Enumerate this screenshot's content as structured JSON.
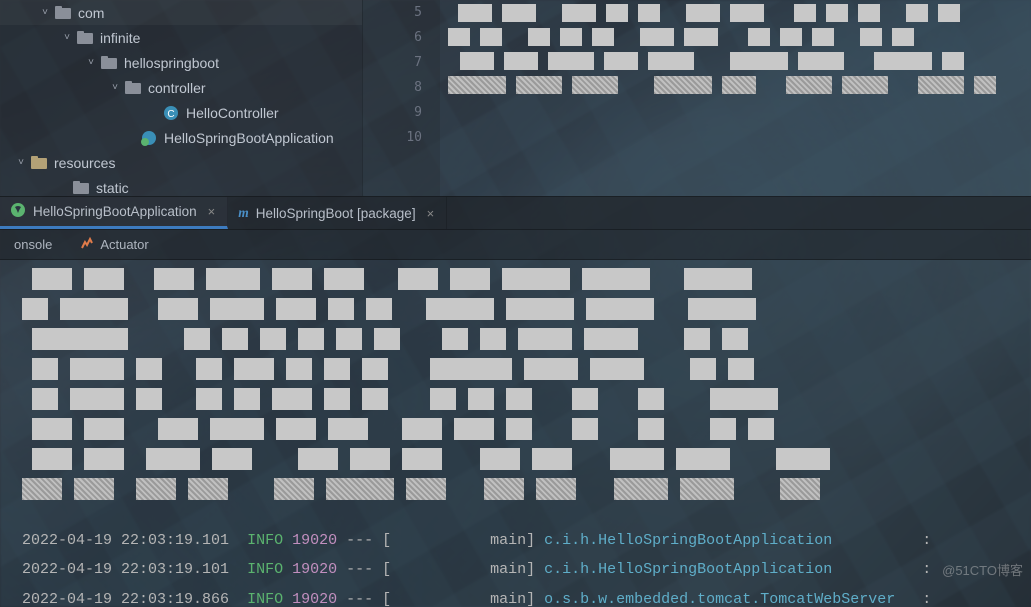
{
  "tree": {
    "items": [
      {
        "indent": 36,
        "arrow": "˅",
        "icon": "folder",
        "label": "com"
      },
      {
        "indent": 58,
        "arrow": "˅",
        "icon": "folder",
        "label": "infinite"
      },
      {
        "indent": 82,
        "arrow": "˅",
        "icon": "folder",
        "label": "hellospringboot"
      },
      {
        "indent": 106,
        "arrow": "˅",
        "icon": "folder",
        "label": "controller"
      },
      {
        "indent": 140,
        "arrow": "",
        "icon": "class",
        "label": "HelloController"
      },
      {
        "indent": 120,
        "arrow": "",
        "icon": "sbapp",
        "label": "HelloSpringBootApplication"
      },
      {
        "indent": 12,
        "arrow": "˅",
        "icon": "resfolder",
        "label": "resources"
      },
      {
        "indent": 52,
        "arrow": "",
        "icon": "folder",
        "label": "static"
      }
    ]
  },
  "gutter": {
    "start": 5,
    "count": 6
  },
  "run_tabs": [
    {
      "icon": "spring",
      "label": "HelloSpringBootApplication",
      "closeable": true,
      "active": true
    },
    {
      "icon": "maven",
      "label": "HelloSpringBoot [package]",
      "closeable": true,
      "active": false
    }
  ],
  "sub_tabs": [
    {
      "label": "onsole"
    },
    {
      "icon": "actuator",
      "label": "Actuator"
    }
  ],
  "logs": [
    {
      "date": "2022-04-19 22:03:19.101",
      "level": "INFO",
      "pid": "19020",
      "sep": " --- [",
      "thread": "           main] ",
      "cls": "c.i.h.HelloSpringBootApplication",
      "tail": "          :"
    },
    {
      "date": "2022-04-19 22:03:19.101",
      "level": "INFO",
      "pid": "19020",
      "sep": " --- [",
      "thread": "           main] ",
      "cls": "c.i.h.HelloSpringBootApplication",
      "tail": "          :"
    },
    {
      "date": "2022-04-19 22:03:19.866",
      "level": "INFO",
      "pid": "19020",
      "sep": " --- [",
      "thread": "           main] ",
      "cls": "o.s.b.w.embedded.tomcat.TomcatWebServer",
      "tail": "   :"
    }
  ],
  "watermark": "@51CTO博客"
}
